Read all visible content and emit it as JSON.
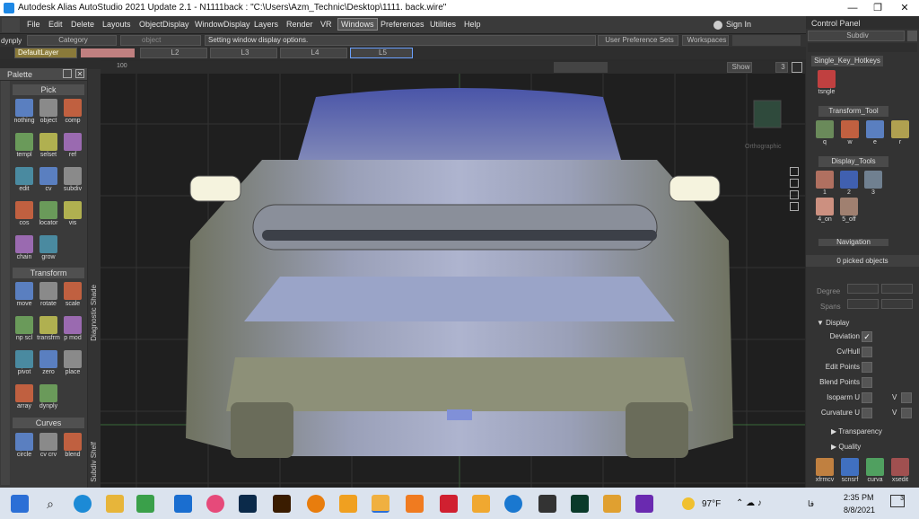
{
  "title_bar": {
    "app_title": "Autodesk Alias AutoStudio 2021 Update 2.1   - N1111back : \"C:\\Users\\Azm_Technic\\Desktop\\1111. back.wire\""
  },
  "menu": {
    "items": [
      "File",
      "Edit",
      "Delete",
      "Layouts",
      "ObjectDisplay",
      "WindowDisplay",
      "Layers",
      "Render",
      "VR",
      "Windows",
      "Preferences",
      "Utilities",
      "Help"
    ],
    "active": "Windows",
    "sign_in": "Sign In"
  },
  "toolbar": {
    "dynply": "dynply",
    "category": "Category",
    "object_placeholder": "object",
    "status": "Setting window display options.",
    "user_prefs": "User Preference Sets",
    "workspaces": "Workspaces",
    "layer": "DefaultLayer",
    "layers": [
      "L2",
      "L3",
      "L4",
      "L5"
    ]
  },
  "palette": {
    "title": "Palette",
    "sections": {
      "pick": "Pick",
      "transform": "Transform",
      "curves": "Curves"
    },
    "pick_tools": [
      "nothing",
      "object",
      "comp",
      "templ",
      "selset",
      "ref",
      "edit",
      "cv",
      "subdiv",
      "cos",
      "locator",
      "vis",
      "chain",
      "grow"
    ],
    "transform_tools": [
      "move",
      "rotate",
      "scale",
      "np scl",
      "transfrm",
      "p mod",
      "pivot",
      "zero",
      "place",
      "array",
      "dynply"
    ],
    "curve_tools": [
      "circle",
      "cv crv",
      "blend"
    ]
  },
  "shelf": {
    "diagnostic": "Diagnostic Shade",
    "subdiv": "Subdiv Shelf"
  },
  "viewport": {
    "scale": "100",
    "show": "Show",
    "num": "3",
    "view_label": "Orthographic"
  },
  "control_panel": {
    "title": "Control Panel",
    "mode": "Subdiv",
    "shelves": {
      "hotkeys": "Single_Key_Hotkeys",
      "transform": "Transform_Tool",
      "display": "Display_Tools",
      "navigation": "Navigation"
    },
    "hotkey_tools": [
      "tsngle"
    ],
    "transform_keys": [
      "q",
      "w",
      "e",
      "r"
    ],
    "display_tools": [
      "1",
      "2",
      "3",
      "4_on",
      "5_off"
    ],
    "picked": "0 picked objects",
    "degree": "Degree",
    "spans": "Spans",
    "display_section": "Display",
    "props": [
      "Deviation",
      "Cv/Hull",
      "Edit Points",
      "Blend Points",
      "Isoparm U",
      "Curvature U"
    ],
    "v_label": "V",
    "transparency": "Transparency",
    "quality": "Quality",
    "bottom_tools": [
      "xfrmcv",
      "scnsrf",
      "curva",
      "xsedit"
    ]
  },
  "taskbar": {
    "weather": "97°F",
    "time": "2:35 PM",
    "date": "8/8/2021",
    "lang": "فا",
    "notif": "3"
  }
}
